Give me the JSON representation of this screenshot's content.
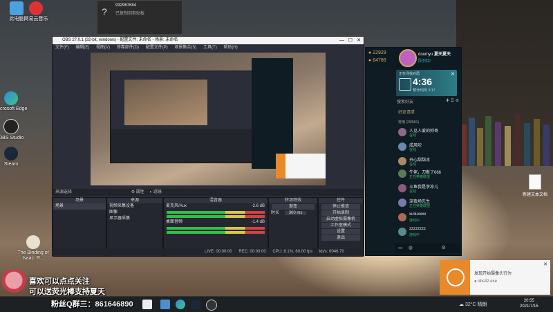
{
  "colors": {
    "accent": "#e8892a",
    "obs_bg": "#2b2e38",
    "wegame_bg": "#0f1c24",
    "timer_bg": "#2d7d88",
    "online": "#3fb46a"
  },
  "desktop": {
    "left_icons": [
      {
        "label": "此电脑",
        "icon": "computer-icon"
      },
      {
        "label": "网易云音乐",
        "icon": "netease-music-icon"
      },
      {
        "label": "OBS Studio",
        "icon": "obs-icon"
      },
      {
        "label": "Microsoft Edge",
        "icon": "edge-icon"
      },
      {
        "label": "Steam",
        "icon": "steam-icon"
      },
      {
        "label": "The Binding of Isaac: R...",
        "icon": "isaac-icon"
      }
    ],
    "right_icon": {
      "label": "新建文本文档",
      "icon": "text-document-icon"
    }
  },
  "top_window": {
    "number": "932967684",
    "sub": "已复制到剪贴板"
  },
  "obs": {
    "title": "OBS 27.0.1 (32-bit, windows) - 配置文件: 未命名 - 场景: 未命名",
    "menu": [
      "文件(F)",
      "编辑(E)",
      "视图(V)",
      "停靠部件(D)",
      "配置文件(P)",
      "场景集合(S)",
      "工具(T)",
      "帮助(H)"
    ],
    "source_label": "来源选择",
    "properties_label": "属性",
    "filters_label": "滤镜",
    "docks": {
      "scenes": {
        "header": "场景",
        "items": [
          "场景"
        ]
      },
      "sources": {
        "header": "来源",
        "items": [
          "视频采集设备",
          "图像",
          "显示器采集"
        ]
      },
      "mixer": {
        "header": "混音器",
        "tracks": [
          {
            "name": "桌面音频",
            "db": "-1.4 dB"
          },
          {
            "name": "麦克风/Aux",
            "db": "-2.6 dB"
          }
        ]
      },
      "transitions": {
        "header": "转场特效",
        "type": "渐变",
        "duration_label": "时长",
        "duration": "300 ms"
      },
      "controls": {
        "header": "控件",
        "buttons": [
          "停止推流",
          "开始录制",
          "启动虚拟摄像机",
          "工作室模式",
          "设置",
          "退出"
        ]
      }
    },
    "status": {
      "live": "LIVE: 00:00:00",
      "rec": "REC: 00:00:00",
      "cpu": "CPU: 8.1%, 60.00 fps",
      "kbps": "kb/s: 6046.70"
    }
  },
  "wegame": {
    "stat1": "22929",
    "stat2": "64786",
    "user_name": "doumyu",
    "user_tag": "夏天夏天",
    "user_status": "队列中",
    "queue_label": "正在寻找对局",
    "timer": "4:36",
    "timer_sub": "预计时间: 3:17",
    "search_placeholder": "搜索好友",
    "friend_request": "好友请求",
    "group_label": "常用 (29/581)",
    "friends": [
      {
        "name": "人见人爱的帅哥",
        "status": "在线"
      },
      {
        "name": "成风吹",
        "status": "在线"
      },
      {
        "name": "开心甜甜冰",
        "status": "在线"
      },
      {
        "name": "牛佬，刀断了666",
        "status": "正在英雄联盟"
      },
      {
        "name": "斗鱼我是李凉儿",
        "status": "在线"
      },
      {
        "name": "深夜场先生",
        "status": "正在英雄联盟"
      },
      {
        "name": "xuliuxxxx",
        "status": "游戏中"
      },
      {
        "name": "zzzzzzzz",
        "status": "游戏中"
      }
    ]
  },
  "overlay": {
    "line1": "喜欢可以点点关注",
    "line2": "可以送荧光棒支持夏天",
    "line3": "粉丝Q群三：861646890"
  },
  "notification": {
    "title": "发现开始摄像头行为",
    "app": "obs32.exe"
  },
  "taskbar": {
    "weather": "32°C 晴朗",
    "time": "20:55",
    "date": "2021/7/15"
  }
}
